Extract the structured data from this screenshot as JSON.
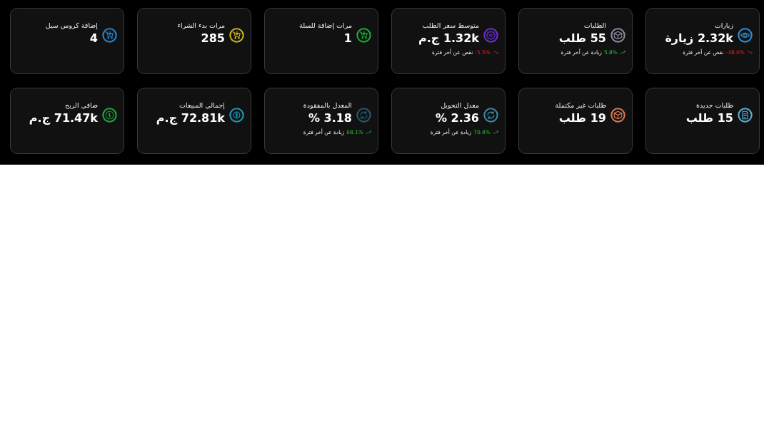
{
  "cards": [
    {
      "title": "زيارات",
      "value": "2.32k زيارة",
      "kind": "eye",
      "color": "#2f8fd8",
      "trend": {
        "kind": "down",
        "percent": "-38.0%",
        "text": "نقص عن أخر فترة"
      }
    },
    {
      "title": "الطلبات",
      "value": "55 طلب",
      "kind": "cube",
      "color": "#8a8aa0",
      "trend": {
        "kind": "up",
        "percent": "5.8%",
        "text": "زيادة عن أخر فترة"
      }
    },
    {
      "title": "متوسط سعر الطلب",
      "value": "1.32k ج.م",
      "kind": "badge",
      "color": "#6a2fd0",
      "trend": {
        "kind": "down",
        "percent": "-5.5%",
        "text": "نقص عن أخر فترة"
      }
    },
    {
      "title": "مرات إضافة للسلة",
      "value": "1",
      "kind": "cart",
      "color": "#1fa83a"
    },
    {
      "title": "مرات بدء الشراء",
      "value": "285",
      "kind": "cart",
      "color": "#c8b416"
    },
    {
      "title": "إضافة كروس سيل",
      "value": "4",
      "kind": "cart",
      "color": "#2a82c8"
    },
    {
      "title": "طلبات جديدة",
      "value": "15 طلب",
      "kind": "document",
      "color": "#5ab0d8"
    },
    {
      "title": "طلبات غير مكتملة",
      "value": "19 طلب",
      "kind": "cube",
      "color": "#d87a50"
    },
    {
      "title": "معدل التحويل",
      "value": "2.36 %",
      "kind": "refresh",
      "color": "#3a8aa8",
      "trend": {
        "kind": "up",
        "percent": "70.4%",
        "text": "زيادة عن أخر فترة"
      }
    },
    {
      "title": "المعدل بالمفقودة",
      "value": "3.18 %",
      "kind": "refresh",
      "color": "#255a70",
      "trend": {
        "kind": "up",
        "percent": "68.1%",
        "text": "زيادة عن أخر فترة"
      }
    },
    {
      "title": "إجمالي المبيعات",
      "value": "72.81k ج.م",
      "kind": "coin",
      "color": "#1a9ab8"
    },
    {
      "title": "صافي الربح",
      "value": "71.47k ج.م",
      "kind": "money",
      "color": "#1ea83a"
    }
  ]
}
